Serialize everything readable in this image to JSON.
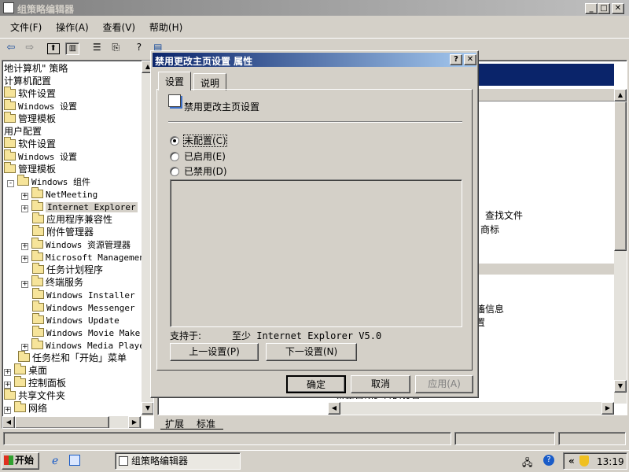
{
  "window": {
    "title": "组策略编辑器"
  },
  "menu": [
    {
      "label": "文件(F)"
    },
    {
      "label": "操作(A)"
    },
    {
      "label": "查看(V)"
    },
    {
      "label": "帮助(H)"
    }
  ],
  "tree": {
    "items": [
      {
        "label": "地计算机\" 策略",
        "indent": 0,
        "expander": "",
        "folder": false,
        "mono": false
      },
      {
        "label": "计算机配置",
        "indent": 0,
        "expander": "",
        "folder": false,
        "mono": false
      },
      {
        "label": "软件设置",
        "indent": 1,
        "expander": "",
        "folder": true,
        "mono": false
      },
      {
        "label": "Windows 设置",
        "indent": 1,
        "expander": "",
        "folder": true,
        "mono": true
      },
      {
        "label": "管理模板",
        "indent": 1,
        "expander": "",
        "folder": true,
        "mono": false
      },
      {
        "label": "用户配置",
        "indent": 0,
        "expander": "",
        "folder": false,
        "mono": false
      },
      {
        "label": "软件设置",
        "indent": 1,
        "expander": "",
        "folder": true,
        "mono": false
      },
      {
        "label": "Windows 设置",
        "indent": 1,
        "expander": "",
        "folder": true,
        "mono": true
      },
      {
        "label": "管理模板",
        "indent": 1,
        "expander": "",
        "folder": true,
        "mono": false
      },
      {
        "label": "Windows 组件",
        "indent": 2,
        "expander": "-",
        "folder": true,
        "mono": true
      },
      {
        "label": "NetMeeting",
        "indent": 3,
        "expander": "+",
        "folder": true,
        "mono": true
      },
      {
        "label": "Internet Explorer",
        "indent": 3,
        "expander": "+",
        "folder": true,
        "mono": true,
        "selected": true
      },
      {
        "label": "应用程序兼容性",
        "indent": 3,
        "expander": "",
        "folder": true,
        "mono": false
      },
      {
        "label": "附件管理器",
        "indent": 3,
        "expander": "",
        "folder": true,
        "mono": false
      },
      {
        "label": "Windows 资源管理器",
        "indent": 3,
        "expander": "+",
        "folder": true,
        "mono": true
      },
      {
        "label": "Microsoft Management",
        "indent": 3,
        "expander": "+",
        "folder": true,
        "mono": true
      },
      {
        "label": "任务计划程序",
        "indent": 3,
        "expander": "",
        "folder": true,
        "mono": false
      },
      {
        "label": "终端服务",
        "indent": 3,
        "expander": "+",
        "folder": true,
        "mono": false
      },
      {
        "label": "Windows Installer",
        "indent": 3,
        "expander": "",
        "folder": true,
        "mono": true
      },
      {
        "label": "Windows Messenger",
        "indent": 3,
        "expander": "",
        "folder": true,
        "mono": true
      },
      {
        "label": "Windows Update",
        "indent": 3,
        "expander": "",
        "folder": true,
        "mono": true
      },
      {
        "label": "Windows Movie Maker",
        "indent": 3,
        "expander": "",
        "folder": true,
        "mono": true
      },
      {
        "label": "Windows Media Player",
        "indent": 3,
        "expander": "+",
        "folder": true,
        "mono": true
      },
      {
        "label": "任务栏和「开始」菜单",
        "indent": 2,
        "expander": "",
        "folder": true,
        "mono": false
      },
      {
        "label": "桌面",
        "indent": 1,
        "expander": "+",
        "folder": true,
        "mono": false
      },
      {
        "label": "控制面板",
        "indent": 1,
        "expander": "+",
        "folder": true,
        "mono": false
      },
      {
        "label": "共享文件夹",
        "indent": 1,
        "expander": "",
        "folder": true,
        "mono": false
      },
      {
        "label": "网络",
        "indent": 1,
        "expander": "+",
        "folder": true,
        "mono": false
      }
    ]
  },
  "right_pane": {
    "fragments": [
      "查找文件",
      "商标",
      "搐信息",
      "置"
    ],
    "bottom_clip": "禁止自动运行的设置"
  },
  "bottom_tabs": [
    {
      "label": "扩展"
    },
    {
      "label": "标准"
    }
  ],
  "dialog": {
    "title": "禁用更改主页设置 属性",
    "tabs": [
      {
        "label": "设置"
      },
      {
        "label": "说明"
      }
    ],
    "setting_name": "禁用更改主页设置",
    "options": [
      {
        "label": "未配置(C)",
        "checked": true
      },
      {
        "label": "已启用(E)",
        "checked": false
      },
      {
        "label": "已禁用(D)",
        "checked": false
      }
    ],
    "supported_label": "支持于:",
    "supported_value": "至少 Internet Explorer V5.0",
    "prev_button": "上一设置(P)",
    "next_button": "下一设置(N)",
    "ok_button": "确定",
    "cancel_button": "取消",
    "apply_button": "应用(A)"
  },
  "taskbar": {
    "start_label": "开始",
    "task_label": "组策略编辑器",
    "clock": "13:19",
    "tray_chevron": "«"
  }
}
